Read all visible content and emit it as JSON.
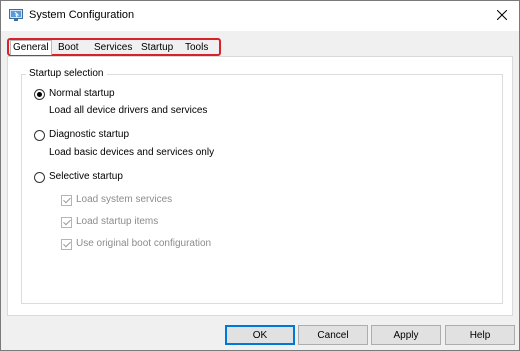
{
  "window": {
    "title": "System Configuration",
    "icon": "system-config-icon",
    "close_icon": "close-icon"
  },
  "tabs": [
    {
      "label": "General",
      "active": true
    },
    {
      "label": "Boot",
      "active": false
    },
    {
      "label": "Services",
      "active": false
    },
    {
      "label": "Startup",
      "active": false
    },
    {
      "label": "Tools",
      "active": false
    }
  ],
  "startup_selection": {
    "legend": "Startup selection",
    "options": [
      {
        "label": "Normal startup",
        "description": "Load all device drivers and services",
        "selected": true
      },
      {
        "label": "Diagnostic startup",
        "description": "Load basic devices and services only",
        "selected": false
      },
      {
        "label": "Selective startup",
        "selected": false
      }
    ],
    "selective_items": [
      {
        "label": "Load system services",
        "checked": true,
        "enabled": false
      },
      {
        "label": "Load startup items",
        "checked": true,
        "enabled": false
      },
      {
        "label": "Use original boot configuration",
        "checked": true,
        "enabled": false
      }
    ]
  },
  "buttons": {
    "ok": "OK",
    "cancel": "Cancel",
    "apply": "Apply",
    "help": "Help"
  },
  "colors": {
    "highlight_border": "#d8222a",
    "default_button_border": "#0078d7"
  }
}
